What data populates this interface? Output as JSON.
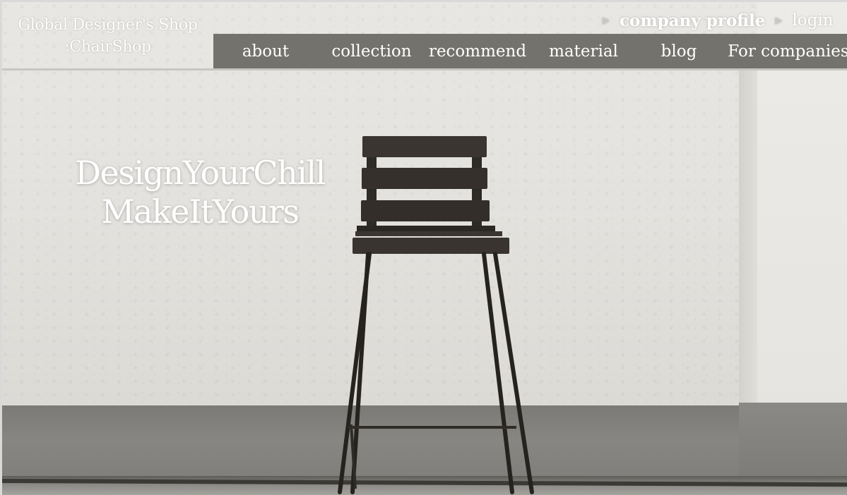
{
  "brand": {
    "line1": "Global Designer's Shop",
    "line2": ":ChairShop"
  },
  "top_links": [
    {
      "label": "company profile",
      "icon": "triangle-right-icon"
    },
    {
      "label": "login",
      "icon": "triangle-right-icon"
    }
  ],
  "nav": [
    "about",
    "collection",
    "recommend",
    "material",
    "blog",
    "For companies"
  ],
  "hero": {
    "line1": "DesignYourChill",
    "line2": "MakeItYours"
  },
  "colors": {
    "nav_bg": "#74726c",
    "text": "#ffffff",
    "wall": "#e5e3df",
    "baseboard": "#82817d"
  }
}
